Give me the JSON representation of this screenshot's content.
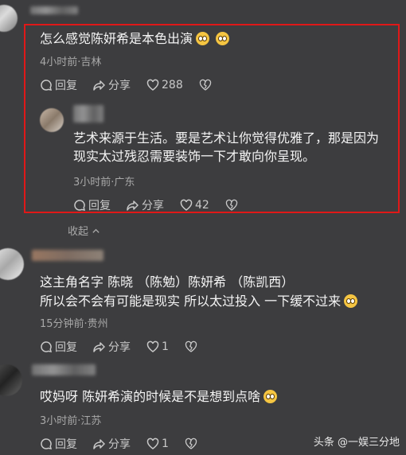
{
  "comments": [
    {
      "text_lines": [
        "怎么感觉陈妍希是本色出演"
      ],
      "emoji_count": 2,
      "meta": "4小时前·吉林",
      "reply": "回复",
      "share": "分享",
      "likes": "288"
    },
    {
      "text_lines": [
        "艺术来源于生活。要是艺术让你觉得优雅了，那是因为",
        "现实太过残忍需要装饰一下才敢向你呈现。"
      ],
      "meta": "3小时前·广东",
      "reply": "回复",
      "share": "分享",
      "likes": "42"
    },
    {
      "text_lines": [
        "这主角名字 陈晓 （陈勉）陈妍希 （陈凯西）",
        "所以会不会有可能是现实 所以太过投入 一下缓不过来"
      ],
      "meta": "15分钟前·贵州",
      "reply": "回复",
      "share": "分享",
      "likes": "1"
    },
    {
      "text_lines": [
        "哎妈呀 陈妍希演的时候是不是想到点啥"
      ],
      "meta": "3小时前·江苏",
      "reply": "回复",
      "share": "分享",
      "likes": "1"
    }
  ],
  "collapse_label": "收起",
  "watermark": "头条 @一娱三分地",
  "colors": {
    "highlight": "#e01818",
    "background": "#3d3d3f"
  }
}
